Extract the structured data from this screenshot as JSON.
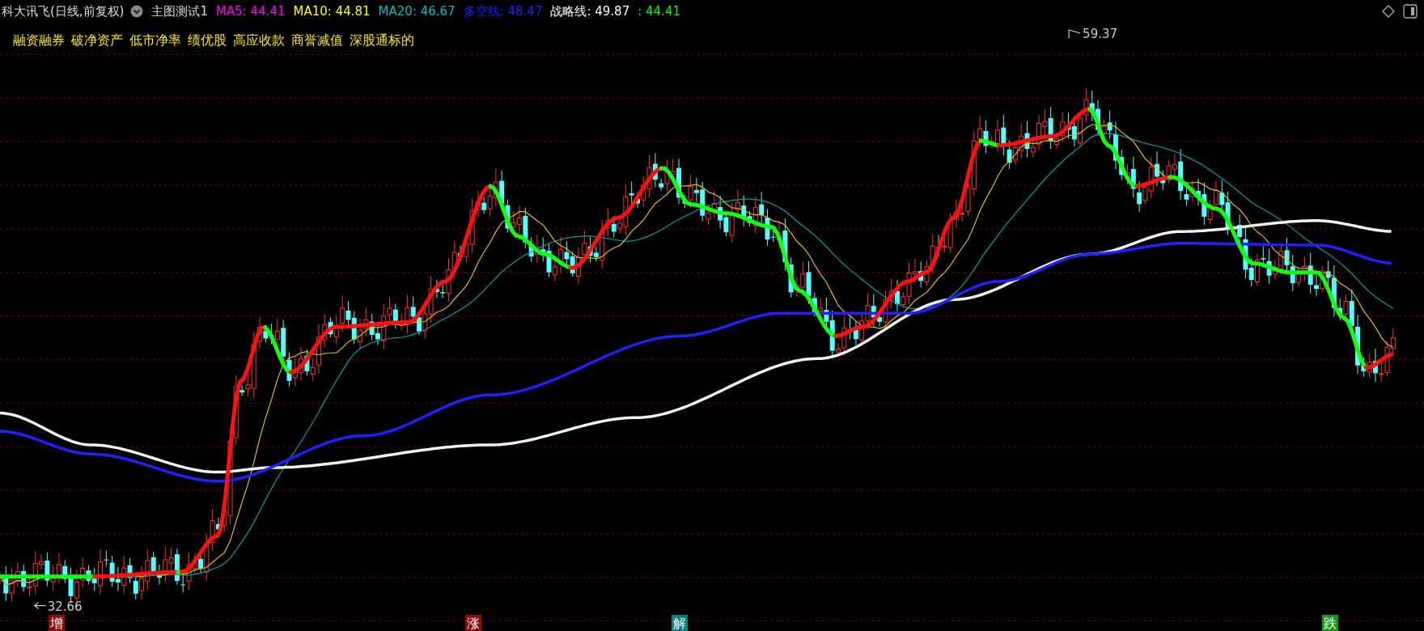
{
  "header": {
    "symbol": "科大讯飞(日线,前复权)",
    "indicator": "主图测试1",
    "values": [
      {
        "label": "MA5: 44.41",
        "color": "#ff00ff"
      },
      {
        "label": "MA10: 44.81",
        "color": "#ffff00"
      },
      {
        "label": "MA20: 46.67",
        "color": "#00c0c0"
      },
      {
        "label": "多空线: 48.47",
        "color": "#2020ff"
      },
      {
        "label": "战略线: 49.87",
        "color": "#ffffff"
      },
      {
        "label": ": 44.41",
        "color": "#00ff00"
      }
    ]
  },
  "tags": [
    "融资融券",
    "破净资产",
    "低市净率",
    "绩优股",
    "高应收款",
    "商誉减值",
    "深股通标的"
  ],
  "chart": {
    "high_label": "59.37",
    "low_label": "32.66"
  },
  "signals": [
    {
      "text": "增",
      "color": "#8b0a0a"
    },
    {
      "text": "涨",
      "color": "#8b0a0a"
    },
    {
      "text": "解",
      "color": "#0a7f7f"
    },
    {
      "text": "跌",
      "color": "#1a9a1a"
    }
  ]
}
